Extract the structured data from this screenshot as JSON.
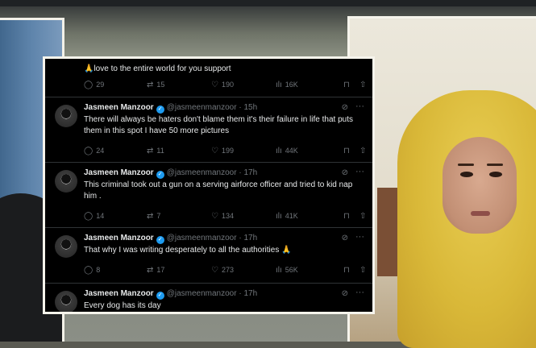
{
  "tweets": [
    {
      "text": "🙏love to the entire world for you support",
      "replies": "29",
      "retweets": "15",
      "likes": "190",
      "views": "16K"
    },
    {
      "name": "Jasmeen Manzoor",
      "handle": "@jasmeenmanzoor",
      "time": "· 15h",
      "text": "There will always be haters don't blame them it's their failure in life that puts them in this spot I have 50 more pictures",
      "replies": "24",
      "retweets": "11",
      "likes": "199",
      "views": "44K"
    },
    {
      "name": "Jasmeen Manzoor",
      "handle": "@jasmeenmanzoor",
      "time": "· 17h",
      "text": "This criminal took out a gun on a serving airforce officer and tried to kid nap him .",
      "replies": "14",
      "retweets": "7",
      "likes": "134",
      "views": "41K"
    },
    {
      "name": "Jasmeen Manzoor",
      "handle": "@jasmeenmanzoor",
      "time": "· 17h",
      "text": "That why I was writing desperately to all the authorities 🙏",
      "replies": "8",
      "retweets": "17",
      "likes": "273",
      "views": "56K"
    },
    {
      "name": "Jasmeen Manzoor",
      "handle": "@jasmeenmanzoor",
      "time": "· 17h",
      "text": "Every dog has its day"
    }
  ],
  "icons": {
    "reply": "speech-bubble-icon",
    "retweet": "retweet-icon",
    "like": "heart-icon",
    "views": "bar-chart-icon",
    "bookmark": "bookmark-icon",
    "share": "share-icon",
    "grok": "grok-icon",
    "more": "more-icon",
    "verified": "verified-badge-icon"
  },
  "colors": {
    "background": "#000000",
    "text": "#e7e9ea",
    "muted": "#71767b",
    "verified": "#1d9bf0"
  }
}
